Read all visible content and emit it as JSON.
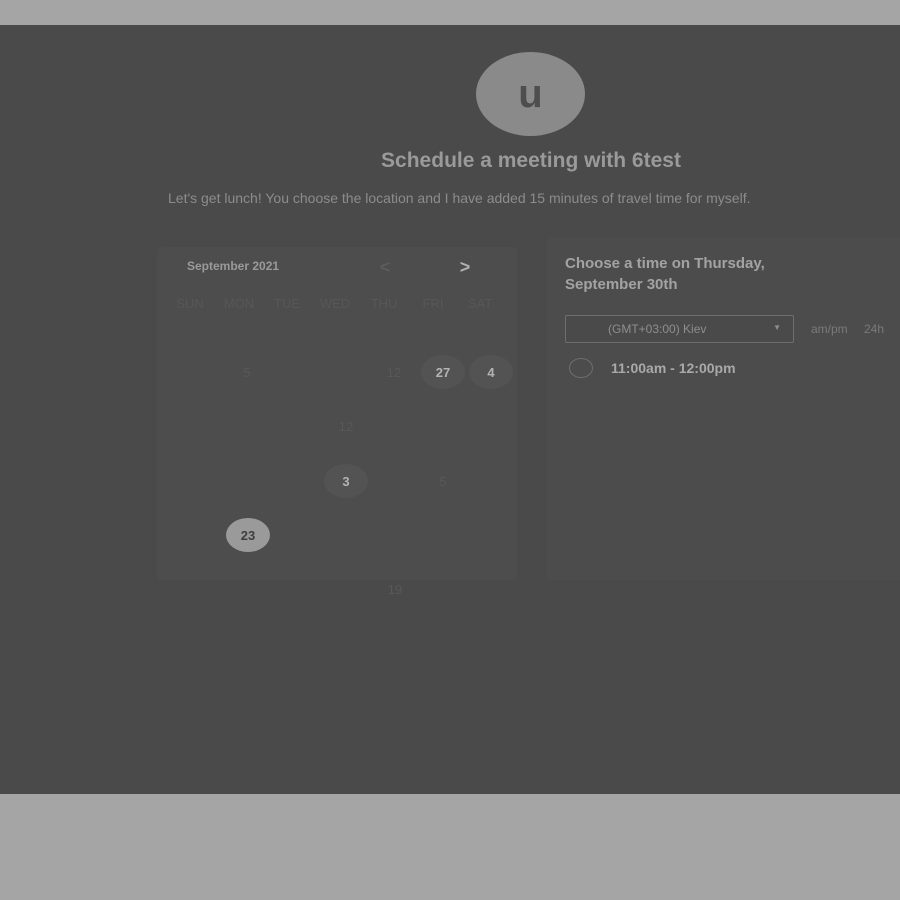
{
  "header": {
    "avatar_initial": "u",
    "title": "Schedule a meeting with 6test",
    "description": "Let's get lunch! You choose the location and I have added 15 minutes of travel time for myself."
  },
  "calendar": {
    "month_label": "September 2021",
    "nav_prev_icon": "chevron-left-icon",
    "nav_next_icon": "chevron-right-icon",
    "prev_glyph": "<",
    "next_glyph": ">",
    "weekdays": [
      "SUN",
      "MON",
      "TUE",
      "WED",
      "THU",
      "FRI",
      "SAT"
    ],
    "days": [
      {
        "label": "5",
        "state": "dim"
      },
      {
        "label": "12",
        "state": "dim"
      },
      {
        "label": "27",
        "state": "available"
      },
      {
        "label": "4",
        "state": "available"
      },
      {
        "label": "12",
        "state": "dim"
      },
      {
        "label": "3",
        "state": "available"
      },
      {
        "label": "5",
        "state": "dim"
      },
      {
        "label": "23",
        "state": "selected"
      },
      {
        "label": "19",
        "state": "dim"
      }
    ]
  },
  "times": {
    "heading": "Choose a time on Thursday, September 30th",
    "timezone": "(GMT+03:00) Kiev",
    "format_ampm": "am/pm",
    "format_24h": "24h",
    "slots": [
      {
        "label": "11:00am - 12:00pm"
      }
    ]
  },
  "colors": {
    "overlay": "#4a4a4a",
    "page_band": "#a5a5a5",
    "available_day": "#535353",
    "selected_day": "#9a9a9a"
  }
}
